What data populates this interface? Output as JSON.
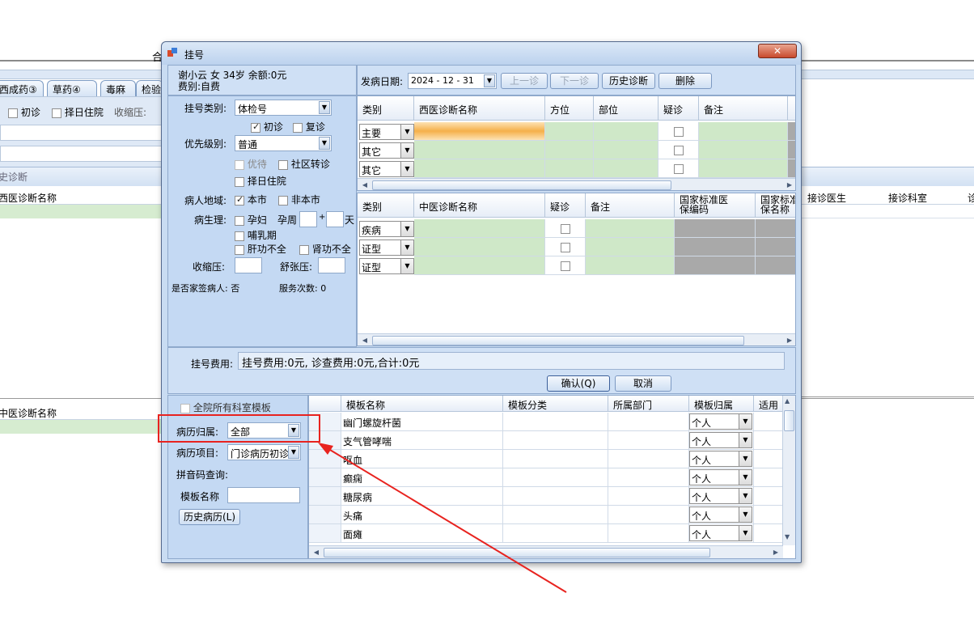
{
  "background": {
    "tabs": [
      "西成药③",
      "草药④",
      "毒麻",
      "检验"
    ],
    "chk_chuzhen": "初诊",
    "chk_zeri": "择日住院",
    "shousuo_label": "收缩压:",
    "history_section": "史诊断",
    "col_xiyi": "西医诊断名称",
    "col_doctor": "接诊医生",
    "col_dept": "接诊科室",
    "col_extra": "诊",
    "col_zhongyi": "中医诊断名称",
    "header_left_char": "合"
  },
  "dialog": {
    "title": "挂号",
    "close": "✕",
    "patient_line1": "谢小云 女 34岁 余额:0元",
    "patient_line2": "费别:自费",
    "guahao_type_label": "挂号类别:",
    "guahao_type_value": "体检号",
    "chuzhen": "初诊",
    "fuzhen": "复诊",
    "priority_label": "优先级别:",
    "priority_value": "普通",
    "youdai": "优待",
    "shequ": "社区转诊",
    "zeri": "择日住院",
    "region_label": "病人地域:",
    "benshi": "本市",
    "feibenshi": "非本市",
    "physio_label": "病生理:",
    "yunfu": "孕妇",
    "yunzhou": "孕周",
    "plus": "+",
    "tian": "天",
    "buru": "哺乳期",
    "gangong": "肝功不全",
    "shengong": "肾功不全",
    "shousuo": "收缩压:",
    "shuzhang": "舒张压:",
    "family_doctor": "是否家签病人: 否",
    "service_count": "服务次数: 0",
    "date_label": "发病日期:",
    "date_value": "2024 - 12 - 31",
    "btn_prev": "上一诊",
    "btn_next": "下一诊",
    "btn_history_diag": "历史诊断",
    "btn_delete": "删除",
    "west_grid": {
      "headers": [
        "类别",
        "西医诊断名称",
        "方位",
        "部位",
        "疑诊",
        "备注"
      ],
      "rows": [
        "主要",
        "其它",
        "其它"
      ]
    },
    "tcm_grid": {
      "headers": [
        "类别",
        "中医诊断名称",
        "疑诊",
        "备注",
        "国家标准医\n保编码",
        "国家标准\n保名称"
      ],
      "rows": [
        "疾病",
        "证型",
        "证型"
      ]
    },
    "fee_label": "挂号费用:",
    "fee_value": "挂号费用:0元, 诊查费用:0元,合计:0元",
    "btn_confirm": "确认(Q)",
    "btn_cancel": "取消",
    "all_templates": "全院所有科室模板",
    "record_owner_label": "病历归属:",
    "record_owner_value": "全部",
    "record_item_label": "病历项目:",
    "record_item_value": "门诊病历初诊",
    "pinyin_label": "拼音码查询:",
    "template_name_label": "模板名称",
    "btn_history_record": "历史病历(L)",
    "template_grid": {
      "headers": [
        "模板名称",
        "模板分类",
        "所属部门",
        "模板归属",
        "适用"
      ],
      "rows": [
        {
          "name": "幽门螺旋杆菌",
          "owner": "个人"
        },
        {
          "name": "支气管哮喘",
          "owner": "个人"
        },
        {
          "name": "呕血",
          "owner": "个人"
        },
        {
          "name": "癫痫",
          "owner": "个人"
        },
        {
          "name": "糖尿病",
          "owner": "个人"
        },
        {
          "name": "头痛",
          "owner": "个人"
        },
        {
          "name": "面瘫",
          "owner": "个人"
        }
      ]
    }
  },
  "colors": {
    "highlight": "#e8231f",
    "dialog_bg": "#c9dcf2",
    "grid_green": "#cfe8c8",
    "selected_cell": "#f5b04a"
  }
}
